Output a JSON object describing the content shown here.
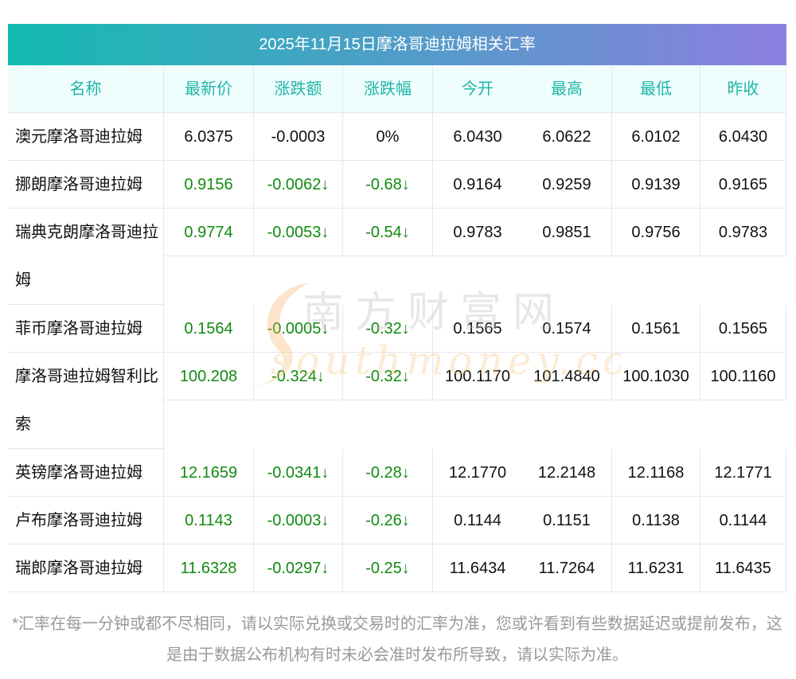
{
  "title": "2025年11月15日摩洛哥迪拉姆相关汇率",
  "headers": [
    "名称",
    "最新价",
    "涨跌额",
    "涨跌幅",
    "今开",
    "最高",
    "最低",
    "昨收"
  ],
  "rows": [
    {
      "name": "澳元摩洛哥迪拉姆",
      "wrap": false,
      "down": false,
      "cells": [
        "6.0375",
        "-0.0003",
        "0%",
        "6.0430",
        "6.0622",
        "6.0102",
        "6.0430"
      ]
    },
    {
      "name": "挪朗摩洛哥迪拉姆",
      "wrap": false,
      "down": true,
      "cells": [
        "0.9156",
        "-0.0062↓",
        "-0.68↓",
        "0.9164",
        "0.9259",
        "0.9139",
        "0.9165"
      ]
    },
    {
      "name": "瑞典克朗摩洛哥迪拉姆",
      "wrap": true,
      "down": true,
      "cells": [
        "0.9774",
        "-0.0053↓",
        "-0.54↓",
        "0.9783",
        "0.9851",
        "0.9756",
        "0.9783"
      ]
    },
    {
      "name": "菲币摩洛哥迪拉姆",
      "wrap": false,
      "down": true,
      "cells": [
        "0.1564",
        "-0.0005↓",
        "-0.32↓",
        "0.1565",
        "0.1574",
        "0.1561",
        "0.1565"
      ]
    },
    {
      "name": "摩洛哥迪拉姆智利比索",
      "wrap": true,
      "down": true,
      "cells": [
        "100.208",
        "-0.324↓",
        "-0.32↓",
        "100.1170",
        "101.4840",
        "100.1030",
        "100.1160"
      ]
    },
    {
      "name": "英镑摩洛哥迪拉姆",
      "wrap": false,
      "down": true,
      "cells": [
        "12.1659",
        "-0.0341↓",
        "-0.28↓",
        "12.1770",
        "12.2148",
        "12.1168",
        "12.1771"
      ]
    },
    {
      "name": "卢布摩洛哥迪拉姆",
      "wrap": false,
      "down": true,
      "cells": [
        "0.1143",
        "-0.0003↓",
        "-0.26↓",
        "0.1144",
        "0.1151",
        "0.1138",
        "0.1144"
      ]
    },
    {
      "name": "瑞郎摩洛哥迪拉姆",
      "wrap": false,
      "down": true,
      "cells": [
        "11.6328",
        "-0.0297↓",
        "-0.25↓",
        "11.6434",
        "11.7264",
        "11.6231",
        "11.6435"
      ]
    }
  ],
  "watermark": {
    "cn": "南方财富网",
    "en": "southmoney.com"
  },
  "note": "*汇率在每一分钟或都不尽相同，请以实际兑换或交易时的汇率为准，您或许看到有些数据延迟或提前发布，这是由于数据公布机构有时未必会准时发布所导致，请以实际为准。"
}
